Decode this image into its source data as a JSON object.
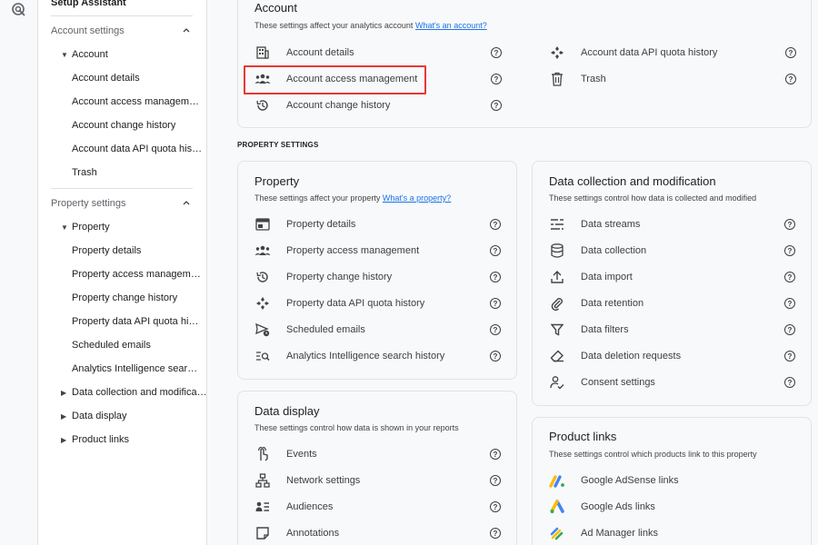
{
  "sidebar": {
    "setup_assistant": "Setup Assistant",
    "account_section": "Account settings",
    "account_parent": "Account",
    "account_items": [
      "Account details",
      "Account access managem…",
      "Account change history",
      "Account data API quota his…",
      "Trash"
    ],
    "property_section": "Property settings",
    "property_parent": "Property",
    "property_items": [
      "Property details",
      "Property access managem…",
      "Property change history",
      "Property data API quota hi…",
      "Scheduled emails",
      "Analytics Intelligence sear…"
    ],
    "collapsed_items": [
      "Data collection and modifica…",
      "Data display",
      "Product links"
    ]
  },
  "account_card": {
    "title": "Account",
    "subtitle": "These settings affect your analytics account",
    "subtitle_link": "What's an account?",
    "left_items": [
      "Account details",
      "Account access management",
      "Account change history"
    ],
    "right_items": [
      "Account data API quota history",
      "Trash"
    ]
  },
  "property_settings_label": "PROPERTY SETTINGS",
  "property_card": {
    "title": "Property",
    "subtitle": "These settings affect your property",
    "subtitle_link": "What's a property?",
    "items": [
      "Property details",
      "Property access management",
      "Property change history",
      "Property data API quota history",
      "Scheduled emails",
      "Analytics Intelligence search history"
    ]
  },
  "data_collection_card": {
    "title": "Data collection and modification",
    "subtitle": "These settings control how data is collected and modified",
    "items": [
      "Data streams",
      "Data collection",
      "Data import",
      "Data retention",
      "Data filters",
      "Data deletion requests",
      "Consent settings"
    ]
  },
  "data_display_card": {
    "title": "Data display",
    "subtitle": "These settings control how data is shown in your reports",
    "items": [
      "Events",
      "Network settings",
      "Audiences",
      "Annotations"
    ]
  },
  "product_links_card": {
    "title": "Product links",
    "subtitle": "These settings control which products link to this property",
    "items": [
      "Google AdSense links",
      "Google Ads links",
      "Ad Manager links"
    ]
  },
  "help_glyph": "?",
  "colors": {
    "highlight": "#e53935",
    "link": "#1a73e8"
  }
}
